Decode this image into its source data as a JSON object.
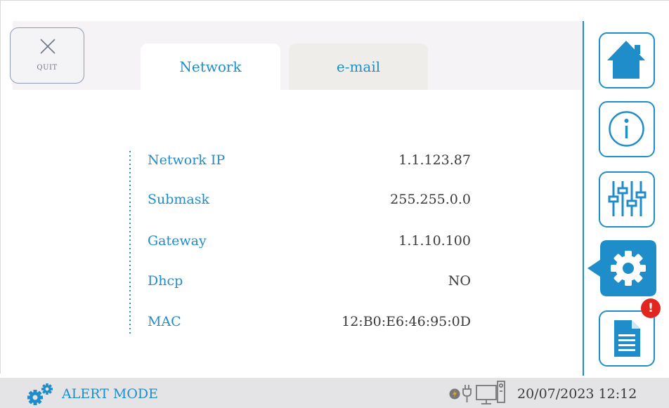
{
  "header": {
    "quit_label": "QUIT",
    "tabs": [
      {
        "label": "Network",
        "active": true
      },
      {
        "label": "e-mail",
        "active": false
      }
    ]
  },
  "network": {
    "rows": [
      {
        "label": "Network IP",
        "value": "1.1.123.87"
      },
      {
        "label": "Submask",
        "value": "255.255.0.0"
      },
      {
        "label": "Gateway",
        "value": "1.1.10.100"
      },
      {
        "label": "Dhcp",
        "value": "NO"
      },
      {
        "label": "MAC",
        "value": "12:B0:E6:46:95:0D"
      }
    ]
  },
  "sidebar": {
    "items": [
      {
        "icon": "home-icon",
        "active": false
      },
      {
        "icon": "info-icon",
        "active": false
      },
      {
        "icon": "sliders-icon",
        "active": false
      },
      {
        "icon": "gear-icon",
        "active": true
      },
      {
        "icon": "report-icon",
        "active": false,
        "badge": "!"
      }
    ]
  },
  "status": {
    "mode": "ALERT MODE",
    "datetime": "20/07/2023 12:12"
  },
  "colors": {
    "accent": "#1e8dc9",
    "alert": "#e0261e",
    "text": "#3a3a3a",
    "status_bg": "#e4e4e6"
  }
}
